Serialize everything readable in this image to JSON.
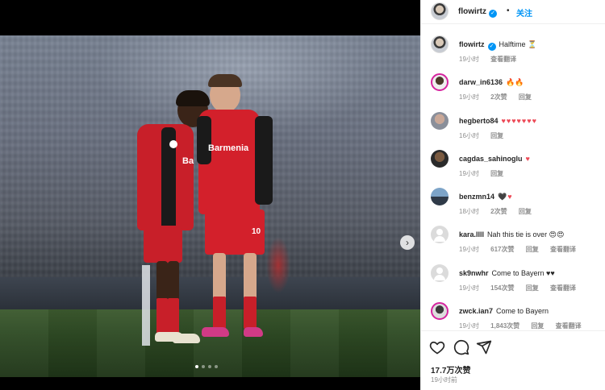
{
  "header": {
    "username": "flowirtz",
    "separator": "•",
    "follow_label": "关注"
  },
  "caption": {
    "username": "flowirtz",
    "text": "Halftime ⏳",
    "time": "19小时",
    "translate": "查看翻译"
  },
  "comments": [
    {
      "user": "darw_in6136",
      "text": "🔥🔥",
      "time": "19小时",
      "likes": "2次赞",
      "reply": "回复",
      "translate": "",
      "avatar": "story"
    },
    {
      "user": "hegberto84",
      "text": "♥♥♥♥♥♥♥",
      "time": "16小时",
      "likes": "",
      "reply": "回复",
      "translate": "",
      "avatar": "photo"
    },
    {
      "user": "cagdas_sahinoglu",
      "text": "♥",
      "time": "19小时",
      "likes": "",
      "reply": "回复",
      "translate": "",
      "avatar": "photo"
    },
    {
      "user": "benzmn14",
      "text": "🖤♥",
      "time": "18小时",
      "likes": "2次赞",
      "reply": "回复",
      "translate": "",
      "avatar": "photo"
    },
    {
      "user": "kara.llll",
      "text": "Nah this tie is over 😍😍",
      "time": "19小时",
      "likes": "617次赞",
      "reply": "回复",
      "translate": "查看翻译",
      "avatar": "default"
    },
    {
      "user": "sk9nwhr",
      "text": "Come to Bayern ♥♥",
      "time": "19小时",
      "likes": "154次赞",
      "reply": "回复",
      "translate": "查看翻译",
      "avatar": "default"
    },
    {
      "user": "zwck.ian7",
      "text": "Come to Bayern",
      "time": "19小时",
      "likes": "1,843次赞",
      "reply": "回复",
      "translate": "查看翻译",
      "avatar": "story"
    }
  ],
  "footer": {
    "likes": "17.7万次赞",
    "posted": "19小时前"
  },
  "media": {
    "sponsor": "Barmenia",
    "sponsor_left": "Ba",
    "shorts_number": "10",
    "carousel_total": 4,
    "carousel_active": 1
  },
  "icons": {
    "like": "heart-outline-icon",
    "comment": "comment-bubble-icon",
    "share": "paper-plane-icon",
    "next": "chevron-right-icon",
    "verified": "verified-badge-icon"
  },
  "colors": {
    "accent": "#0095f6",
    "kit_red": "#d3202b",
    "heart": "#ed4956",
    "story_ring": "#d6249f"
  }
}
